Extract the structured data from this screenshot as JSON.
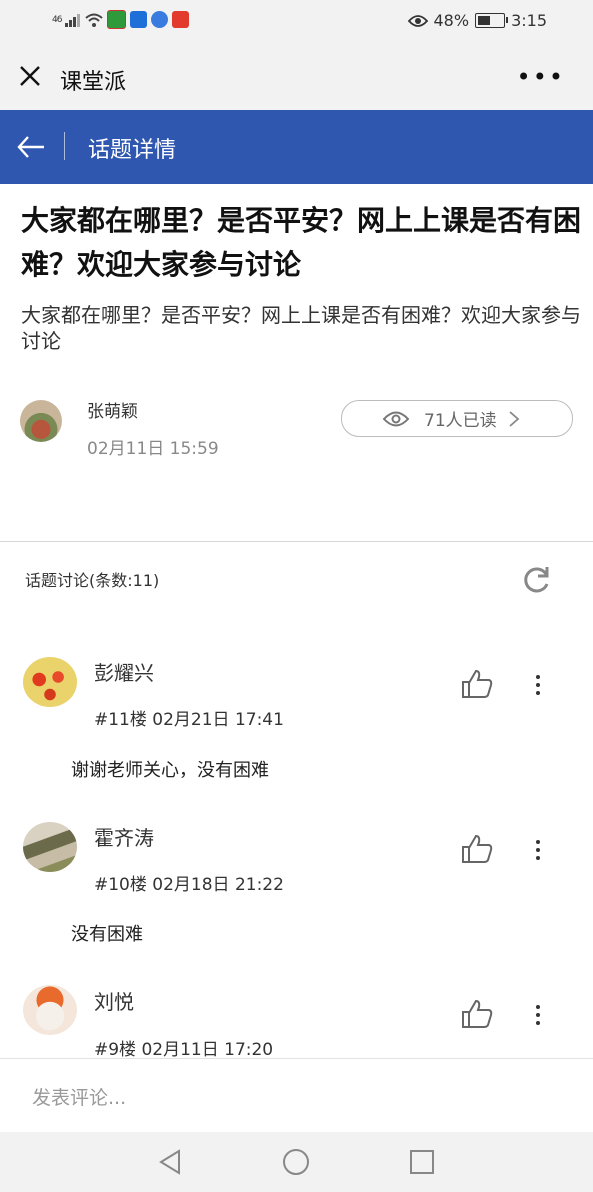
{
  "status_bar": {
    "network": "46",
    "battery_percent": "48%",
    "battery_level": 0.48,
    "time": "3:15",
    "icons": [
      "signal-icon",
      "wifi-icon",
      "app-icon-green",
      "app-icon-blue",
      "app-icon-music",
      "app-icon-red",
      "eye-icon",
      "battery-icon"
    ]
  },
  "title_bar": {
    "title": "课堂派"
  },
  "topic_bar": {
    "title": "话题详情"
  },
  "post": {
    "title": "大家都在哪里？是否平安？网上上课是否有困难？欢迎大家参与讨论",
    "body": "大家都在哪里？是否平安？网上上课是否有困难？欢迎大家参与讨论",
    "author": "张萌颖",
    "time": "02月11日 15:59",
    "reads": "71人已读"
  },
  "discussion": {
    "header": "话题讨论(条数:11)",
    "comments": [
      {
        "name": "彭耀兴",
        "meta": "#11楼 02月21日 17:41",
        "text": "谢谢老师关心，没有困难"
      },
      {
        "name": "霍齐涛",
        "meta": "#10楼 02月18日 21:22",
        "text": "没有困难"
      },
      {
        "name": "刘悦",
        "meta": "#9楼 02月11日 17:20",
        "text": ""
      }
    ]
  },
  "composer": {
    "placeholder": "发表评论..."
  },
  "colors": {
    "brand_blue": "#2f57b0",
    "bar_gray": "#f2f2f2"
  }
}
